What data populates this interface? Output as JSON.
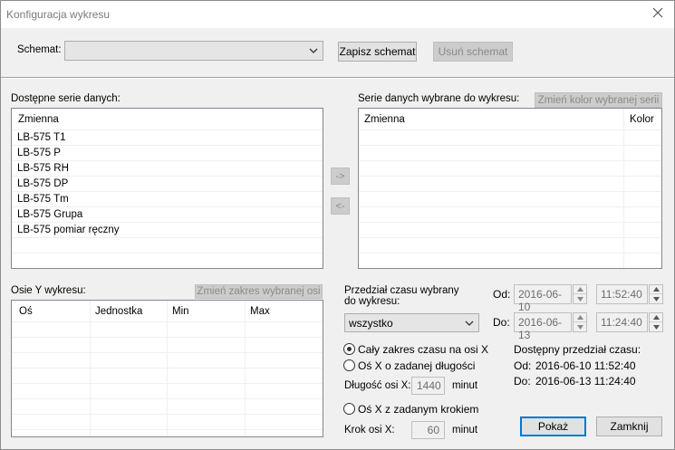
{
  "window": {
    "title": "Konfiguracja wykresu"
  },
  "schema": {
    "label": "Schemat:",
    "value": "",
    "save_label": "Zapisz schemat",
    "delete_label": "Usuń schemat"
  },
  "available": {
    "title": "Dostępne serie danych:",
    "header": "Zmienna",
    "items": [
      "LB-575 T1",
      "LB-575 P",
      "LB-575 RH",
      "LB-575 DP",
      "LB-575 Tm",
      "LB-575 Grupa",
      "LB-575 pomiar ręczny"
    ]
  },
  "transfer": {
    "add_label": "->",
    "remove_label": "<-"
  },
  "selected": {
    "title": "Serie danych wybrane do wykresu:",
    "change_color_label": "Zmień kolor wybranej serii",
    "col_variable": "Zmienna",
    "col_color": "Kolor"
  },
  "axes": {
    "title": "Osie Y wykresu:",
    "change_range_label": "Zmień zakres wybranej osi",
    "col_axis": "Oś",
    "col_unit": "Jednostka",
    "col_min": "Min",
    "col_max": "Max"
  },
  "time": {
    "title_line1": "Przedział czasu wybrany",
    "title_line2": "do wykresu:",
    "range_value": "wszystko",
    "from_label": "Od:",
    "from_date": "2016-06-10",
    "from_time": "11:52:40",
    "to_label": "Do:",
    "to_date": "2016-06-13",
    "to_time": "11:24:40",
    "opt_full": "Cały zakres czasu na osi X",
    "opt_length": "Oś X o zadanej długości",
    "length_label": "Długość osi X:",
    "length_value": "1440",
    "length_unit": "minut",
    "opt_step": "Oś X z zadanym krokiem",
    "step_label": "Krok osi X:",
    "step_value": "60",
    "step_unit": "minut",
    "available_title": "Dostępny przedział czasu:",
    "available_from_label": "Od:",
    "available_from": "2016-06-10 11:52:40",
    "available_to_label": "Do:",
    "available_to": "2016-06-13 11:24:40"
  },
  "actions": {
    "show_label": "Pokaż",
    "close_label": "Zamknij"
  }
}
